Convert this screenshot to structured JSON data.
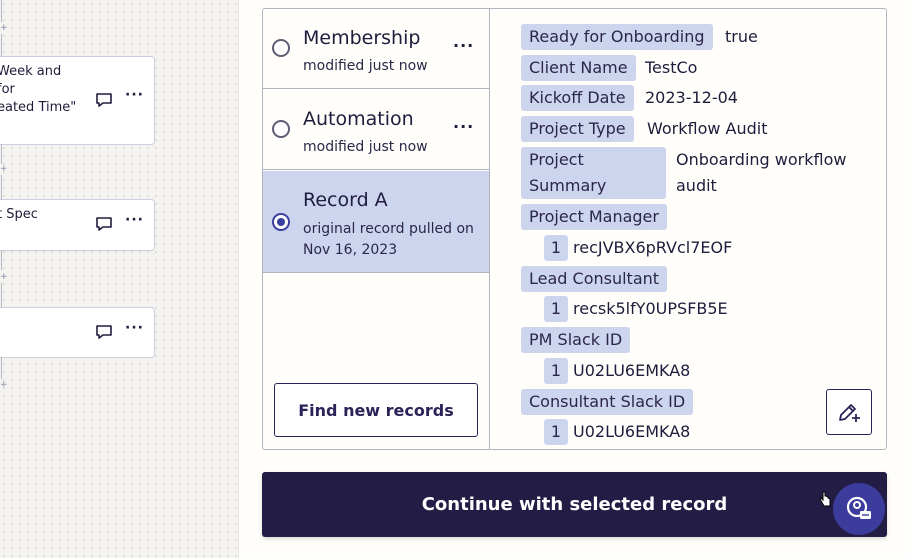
{
  "canvas": {
    "cards": [
      {
        "text": "Week and\nfor\neated Time\""
      },
      {
        "text": "t Spec"
      },
      {
        "text": ""
      }
    ]
  },
  "records": [
    {
      "title": "Membership",
      "subtitle": "modified just now",
      "selected": false
    },
    {
      "title": "Automation",
      "subtitle": "modified just now",
      "selected": false
    },
    {
      "title": "Record A",
      "subtitle": "original record pulled on Nov 16, 2023",
      "selected": true
    }
  ],
  "find_button_label": "Find new records",
  "fields": {
    "ready_label": "Ready for Onboarding",
    "ready_value": "true",
    "client_label": "Client Name",
    "client_value": "TestCo",
    "kickoff_label": "Kickoff Date",
    "kickoff_value": "2023-12-04",
    "ptype_label": "Project Type",
    "ptype_value": "Workflow Audit",
    "summary_label": "Project Summary",
    "summary_value": "Onboarding workflow audit",
    "pm_label": "Project Manager",
    "pm_index": "1",
    "pm_value": "recJVBX6pRVcl7EOF",
    "lead_label": "Lead Consultant",
    "lead_index": "1",
    "lead_value": "recsk5lfY0UPSFB5E",
    "pmslack_label": "PM Slack ID",
    "pmslack_index": "1",
    "pmslack_value": "U02LU6EMKA8",
    "cslack_label": "Consultant Slack ID",
    "cslack_index": "1",
    "cslack_value": "U02LU6EMKA8"
  },
  "continue_label": "Continue with selected record",
  "icons": {
    "edit": "pencil-plus-icon",
    "help": "help-chat-icon",
    "comment": "comment-icon",
    "more": "more-dots-icon"
  },
  "colors": {
    "primary": "#231d46",
    "selected_bg": "#cdd4ed",
    "label_bg": "#cdd4ed",
    "fab": "#3c3c9c"
  }
}
